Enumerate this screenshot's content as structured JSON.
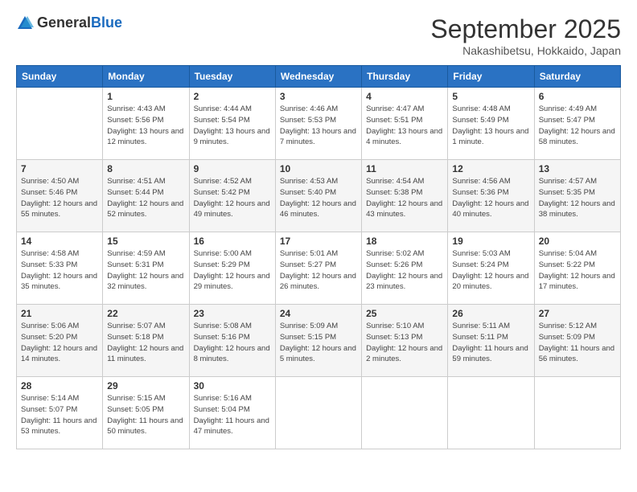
{
  "logo": {
    "general": "General",
    "blue": "Blue"
  },
  "title": "September 2025",
  "location": "Nakashibetsu, Hokkaido, Japan",
  "headers": [
    "Sunday",
    "Monday",
    "Tuesday",
    "Wednesday",
    "Thursday",
    "Friday",
    "Saturday"
  ],
  "rows": [
    [
      {
        "day": "",
        "info": ""
      },
      {
        "day": "1",
        "info": "Sunrise: 4:43 AM\nSunset: 5:56 PM\nDaylight: 13 hours\nand 12 minutes."
      },
      {
        "day": "2",
        "info": "Sunrise: 4:44 AM\nSunset: 5:54 PM\nDaylight: 13 hours\nand 9 minutes."
      },
      {
        "day": "3",
        "info": "Sunrise: 4:46 AM\nSunset: 5:53 PM\nDaylight: 13 hours\nand 7 minutes."
      },
      {
        "day": "4",
        "info": "Sunrise: 4:47 AM\nSunset: 5:51 PM\nDaylight: 13 hours\nand 4 minutes."
      },
      {
        "day": "5",
        "info": "Sunrise: 4:48 AM\nSunset: 5:49 PM\nDaylight: 13 hours\nand 1 minute."
      },
      {
        "day": "6",
        "info": "Sunrise: 4:49 AM\nSunset: 5:47 PM\nDaylight: 12 hours\nand 58 minutes."
      }
    ],
    [
      {
        "day": "7",
        "info": "Sunrise: 4:50 AM\nSunset: 5:46 PM\nDaylight: 12 hours\nand 55 minutes."
      },
      {
        "day": "8",
        "info": "Sunrise: 4:51 AM\nSunset: 5:44 PM\nDaylight: 12 hours\nand 52 minutes."
      },
      {
        "day": "9",
        "info": "Sunrise: 4:52 AM\nSunset: 5:42 PM\nDaylight: 12 hours\nand 49 minutes."
      },
      {
        "day": "10",
        "info": "Sunrise: 4:53 AM\nSunset: 5:40 PM\nDaylight: 12 hours\nand 46 minutes."
      },
      {
        "day": "11",
        "info": "Sunrise: 4:54 AM\nSunset: 5:38 PM\nDaylight: 12 hours\nand 43 minutes."
      },
      {
        "day": "12",
        "info": "Sunrise: 4:56 AM\nSunset: 5:36 PM\nDaylight: 12 hours\nand 40 minutes."
      },
      {
        "day": "13",
        "info": "Sunrise: 4:57 AM\nSunset: 5:35 PM\nDaylight: 12 hours\nand 38 minutes."
      }
    ],
    [
      {
        "day": "14",
        "info": "Sunrise: 4:58 AM\nSunset: 5:33 PM\nDaylight: 12 hours\nand 35 minutes."
      },
      {
        "day": "15",
        "info": "Sunrise: 4:59 AM\nSunset: 5:31 PM\nDaylight: 12 hours\nand 32 minutes."
      },
      {
        "day": "16",
        "info": "Sunrise: 5:00 AM\nSunset: 5:29 PM\nDaylight: 12 hours\nand 29 minutes."
      },
      {
        "day": "17",
        "info": "Sunrise: 5:01 AM\nSunset: 5:27 PM\nDaylight: 12 hours\nand 26 minutes."
      },
      {
        "day": "18",
        "info": "Sunrise: 5:02 AM\nSunset: 5:26 PM\nDaylight: 12 hours\nand 23 minutes."
      },
      {
        "day": "19",
        "info": "Sunrise: 5:03 AM\nSunset: 5:24 PM\nDaylight: 12 hours\nand 20 minutes."
      },
      {
        "day": "20",
        "info": "Sunrise: 5:04 AM\nSunset: 5:22 PM\nDaylight: 12 hours\nand 17 minutes."
      }
    ],
    [
      {
        "day": "21",
        "info": "Sunrise: 5:06 AM\nSunset: 5:20 PM\nDaylight: 12 hours\nand 14 minutes."
      },
      {
        "day": "22",
        "info": "Sunrise: 5:07 AM\nSunset: 5:18 PM\nDaylight: 12 hours\nand 11 minutes."
      },
      {
        "day": "23",
        "info": "Sunrise: 5:08 AM\nSunset: 5:16 PM\nDaylight: 12 hours\nand 8 minutes."
      },
      {
        "day": "24",
        "info": "Sunrise: 5:09 AM\nSunset: 5:15 PM\nDaylight: 12 hours\nand 5 minutes."
      },
      {
        "day": "25",
        "info": "Sunrise: 5:10 AM\nSunset: 5:13 PM\nDaylight: 12 hours\nand 2 minutes."
      },
      {
        "day": "26",
        "info": "Sunrise: 5:11 AM\nSunset: 5:11 PM\nDaylight: 11 hours\nand 59 minutes."
      },
      {
        "day": "27",
        "info": "Sunrise: 5:12 AM\nSunset: 5:09 PM\nDaylight: 11 hours\nand 56 minutes."
      }
    ],
    [
      {
        "day": "28",
        "info": "Sunrise: 5:14 AM\nSunset: 5:07 PM\nDaylight: 11 hours\nand 53 minutes."
      },
      {
        "day": "29",
        "info": "Sunrise: 5:15 AM\nSunset: 5:05 PM\nDaylight: 11 hours\nand 50 minutes."
      },
      {
        "day": "30",
        "info": "Sunrise: 5:16 AM\nSunset: 5:04 PM\nDaylight: 11 hours\nand 47 minutes."
      },
      {
        "day": "",
        "info": ""
      },
      {
        "day": "",
        "info": ""
      },
      {
        "day": "",
        "info": ""
      },
      {
        "day": "",
        "info": ""
      }
    ]
  ]
}
